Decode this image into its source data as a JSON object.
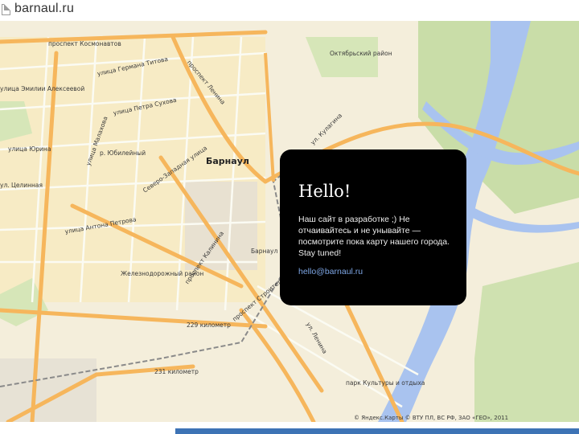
{
  "tab": {
    "title": "barnaul.ru",
    "icon": "page-icon"
  },
  "map": {
    "city_label": "Барнаул",
    "labels": {
      "kosmonavtov": "проспект Космонавтов",
      "titova": "улица Германа Титова",
      "lenina": "проспект Ленина",
      "oktyabrsky": "Октябрьский район",
      "ekaterinburgskaya": "улица Эмилии Алексеевой",
      "sukhova": "улица Петра Сухова",
      "kulagina": "ул. Кулагина",
      "yurina": "улица Юрина",
      "malakhova": "улица Малахова",
      "yubileiny": "р. Юбилейный",
      "severo_zapadnaya": "Северо-Западная улица",
      "antona_petrova": "улица Антона Петрова",
      "tselinnaya": "ул. Целинная",
      "zheleznodorozhny": "Железнодорожный район",
      "sputnikov": "проспект Строителей",
      "kommunarov": "проспект Калинина",
      "km229": "229 километр",
      "km231": "231 километр",
      "lenin_ave": "ул. Ленина",
      "park": "парк Культуры и отдыха",
      "barnaul_station": "Барнаул",
      "attribution": "© Яндекс.Карты © ВТУ ПЛ, ВС РФ, ЗАО «ГЕО», 2011"
    }
  },
  "popup": {
    "title": "Hello!",
    "message": "Наш сайт в разработке ;) Не отчаивайтесь и не унывайте — посмотрите пока карту нашего города. Stay tuned!",
    "email": "hello@barnaul.ru"
  },
  "colors": {
    "popup_bg": "#000000",
    "email": "#7ea7e6",
    "river": "#a9c3ef",
    "park": "#c5dba5",
    "road_major": "#f6b65c"
  }
}
